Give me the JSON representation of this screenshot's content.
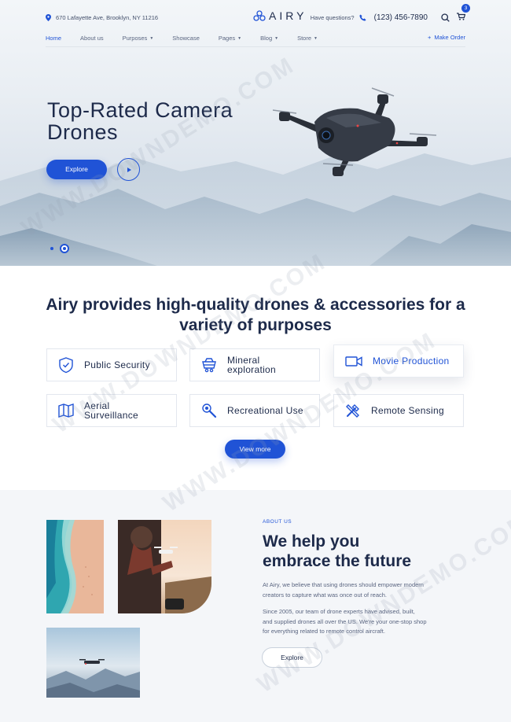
{
  "topbar": {
    "address": "670 Lafayette Ave, Brooklyn, NY 11216",
    "logo": "AIRY",
    "question": "Have questions?",
    "phone": "(123) 456-7890",
    "cart_count": "3"
  },
  "nav": {
    "items": [
      {
        "label": "Home",
        "active": true,
        "dropdown": false
      },
      {
        "label": "About us",
        "active": false,
        "dropdown": false
      },
      {
        "label": "Purposes",
        "active": false,
        "dropdown": true
      },
      {
        "label": "Showcase",
        "active": false,
        "dropdown": false
      },
      {
        "label": "Pages",
        "active": false,
        "dropdown": true
      },
      {
        "label": "Blog",
        "active": false,
        "dropdown": true
      },
      {
        "label": "Store",
        "active": false,
        "dropdown": true
      }
    ],
    "make_order": "Make Order"
  },
  "hero": {
    "title_line1": "Top-Rated Camera",
    "title_line2": "Drones",
    "explore": "Explore"
  },
  "features": {
    "heading_line1": "Airy provides high-quality drones & accessories for a",
    "heading_line2": "variety of purposes",
    "cards": [
      {
        "line1": "Public Security",
        "line2": "",
        "icon": "shield-check-icon"
      },
      {
        "line1": "Mineral",
        "line2": "exploration",
        "icon": "mine-cart-icon"
      },
      {
        "line1": "Movie Production",
        "line2": "",
        "icon": "video-camera-icon"
      },
      {
        "line1": "Aerial",
        "line2": "Surveillance",
        "icon": "map-icon"
      },
      {
        "line1": "Recreational Use",
        "line2": "",
        "icon": "joystick-icon"
      },
      {
        "line1": "Remote Sensing",
        "line2": "",
        "icon": "tools-icon"
      }
    ],
    "view_more": "View more"
  },
  "about": {
    "eyebrow": "ABOUT US",
    "title_line1": "We help you",
    "title_line2": "embrace the future",
    "p1_line1": "At Airy, we believe that using drones should empower modern",
    "p1_line2": "creators to capture what was once out of reach.",
    "p2_line1": "Since 2005, our team of drone experts have advised, built,",
    "p2_line2": "and supplied drones all over the US. We're your one-stop shop",
    "p2_line3": "for everything related to remote control aircraft.",
    "explore": "Explore"
  },
  "watermark": "WWW.DOWNDEMO.COM",
  "colors": {
    "accent": "#2053d6",
    "text": "#1d2a4a",
    "muted": "#5a6580",
    "section_bg": "#f4f6f9"
  }
}
